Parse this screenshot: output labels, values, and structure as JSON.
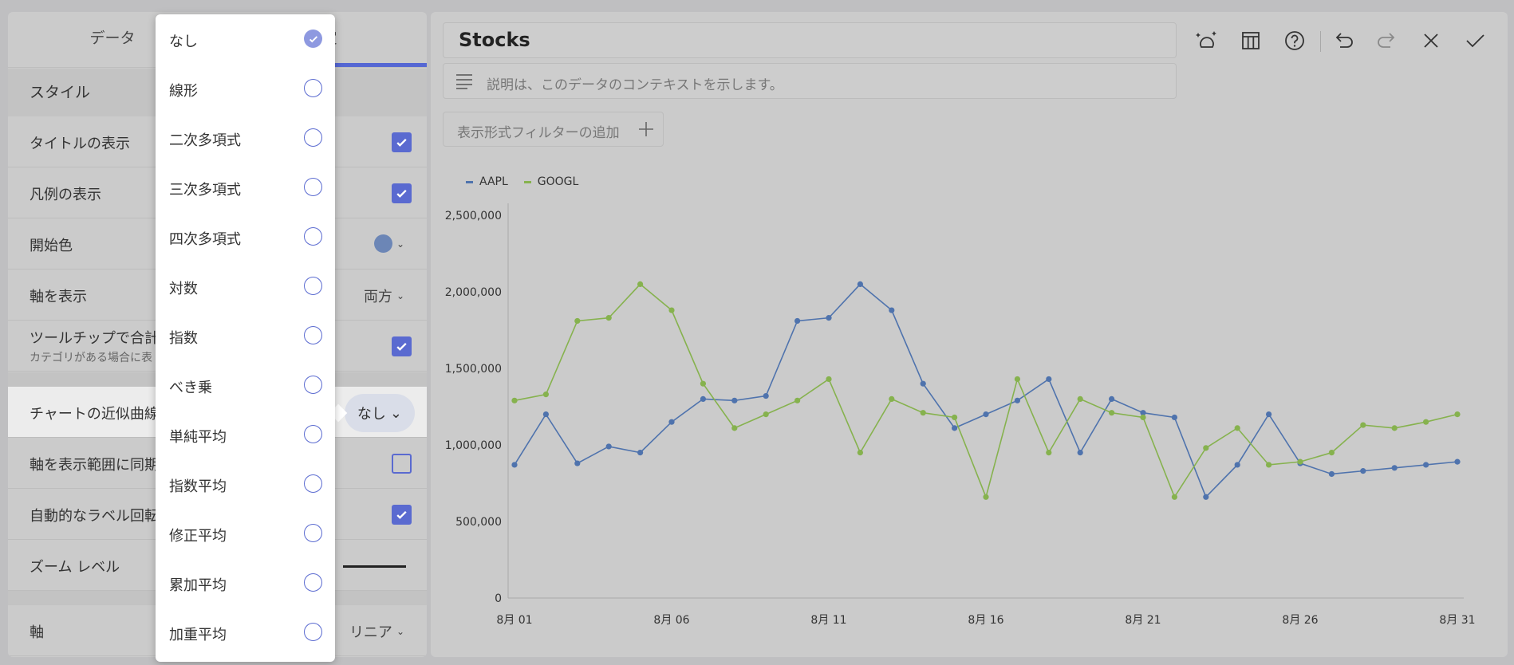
{
  "left_panel": {
    "tabs": [
      "データ",
      "設定"
    ],
    "style_section": "スタイル",
    "rows": {
      "show_title": "タイトルの表示",
      "show_legend": "凡例の表示",
      "start_color": "開始色",
      "show_axis": "軸を表示",
      "show_axis_value": "両方",
      "tooltip_total": "ツールチップで合計",
      "tooltip_sub": "カテゴリがある場合に表",
      "trendline": "チャートの近似曲線",
      "trendline_value": "なし",
      "sync_axis": "軸を表示範囲に同期",
      "auto_label_rotation": "自動的なラベル回転",
      "zoom_level": "ズーム レベル",
      "axis": "軸",
      "axis_value": "リニア"
    },
    "start_color_hex": "#6c86b6",
    "checked": {
      "show_title": true,
      "show_legend": true,
      "tooltip_total": true,
      "sync_axis": false,
      "auto_label_rotation": true
    }
  },
  "dropdown": {
    "items": [
      "なし",
      "線形",
      "二次多項式",
      "三次多項式",
      "四次多項式",
      "対数",
      "指数",
      "べき乗",
      "単純平均",
      "指数平均",
      "修正平均",
      "累加平均",
      "加重平均"
    ],
    "selected": "なし"
  },
  "main": {
    "title": "Stocks",
    "description_placeholder": "説明は、このデータのコンテキストを示します。",
    "filter_button": "表示形式フィルターの追加",
    "toolbar_icons": [
      "magic-theme-icon",
      "grid-table-icon",
      "help-icon",
      "undo-icon",
      "redo-icon",
      "close-icon",
      "confirm-check-icon"
    ]
  },
  "chart_data": {
    "type": "line",
    "x": [
      "8月 01",
      "8月 02",
      "8月 03",
      "8月 04",
      "8月 05",
      "8月 06",
      "8月 07",
      "8月 08",
      "8月 09",
      "8月 10",
      "8月 11",
      "8月 12",
      "8月 13",
      "8月 14",
      "8月 15",
      "8月 16",
      "8月 17",
      "8月 18",
      "8月 19",
      "8月 20",
      "8月 21",
      "8月 22",
      "8月 23",
      "8月 24",
      "8月 25",
      "8月 26",
      "8月 27",
      "8月 28",
      "8月 29",
      "8月 30",
      "8月 31"
    ],
    "x_tick_labels": [
      "8月 01",
      "8月 06",
      "8月 11",
      "8月 16",
      "8月 21",
      "8月 26",
      "8月 31"
    ],
    "series": [
      {
        "name": "AAPL",
        "color": "#4f73ad",
        "values": [
          870000,
          1200000,
          880000,
          990000,
          950000,
          1150000,
          1300000,
          1290000,
          1320000,
          1810000,
          1830000,
          2050000,
          1880000,
          1400000,
          1110000,
          1200000,
          1290000,
          1430000,
          950000,
          1300000,
          1210000,
          1180000,
          660000,
          870000,
          1200000,
          880000,
          810000,
          830000,
          850000,
          870000,
          890000
        ]
      },
      {
        "name": "GOOGL",
        "color": "#86b24e",
        "values": [
          1290000,
          1330000,
          1810000,
          1830000,
          2050000,
          1880000,
          1400000,
          1110000,
          1200000,
          1290000,
          1430000,
          950000,
          1300000,
          1210000,
          1180000,
          660000,
          1430000,
          950000,
          1300000,
          1210000,
          1180000,
          660000,
          980000,
          1110000,
          870000,
          890000,
          950000,
          1130000,
          1110000,
          1150000,
          1200000
        ]
      }
    ],
    "y_tick_labels": [
      "0",
      "500,000",
      "1,000,000",
      "1,500,000",
      "2,000,000",
      "2,500,000"
    ],
    "ylim": [
      0,
      2500000
    ],
    "legend_position": "top-left",
    "grid": false
  }
}
